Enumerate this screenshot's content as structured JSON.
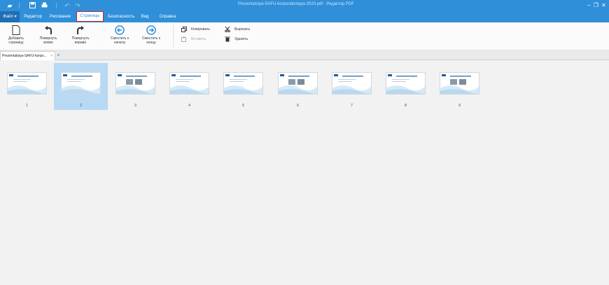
{
  "titlebar": {
    "title": "Presentatsiya-SAFU-korporativnaya-2020.pdf - Редактор PDF"
  },
  "menu": {
    "file": "Файл ▾",
    "items": [
      "Редактор",
      "Рисование",
      "Страницы",
      "Безопасность",
      "Вид",
      "Справка"
    ],
    "active": "Страницы"
  },
  "ribbon": {
    "add_page": "Добавить страницу",
    "rotate_left": "Повернуть влево",
    "rotate_right": "Повернуть вправо",
    "move_start": "Сместить к началу",
    "move_end": "Сместить к концу",
    "copy": "Копировать",
    "paste": "Вставить",
    "cut": "Вырезать",
    "delete": "Удалить"
  },
  "tabs": {
    "document": "Prezentatsiya-SAFU-korpo...",
    "close": "×",
    "add": "+"
  },
  "pages": [
    {
      "number": "1",
      "selected": false
    },
    {
      "number": "2",
      "selected": true
    },
    {
      "number": "3",
      "selected": false
    },
    {
      "number": "4",
      "selected": false
    },
    {
      "number": "5",
      "selected": false
    },
    {
      "number": "6",
      "selected": false
    },
    {
      "number": "7",
      "selected": false
    },
    {
      "number": "8",
      "selected": false
    },
    {
      "number": "9",
      "selected": false
    }
  ],
  "colors": {
    "accent": "#2f8fd9",
    "selected": "#b8d9f4",
    "active_tab_border": "#d21f2b"
  }
}
